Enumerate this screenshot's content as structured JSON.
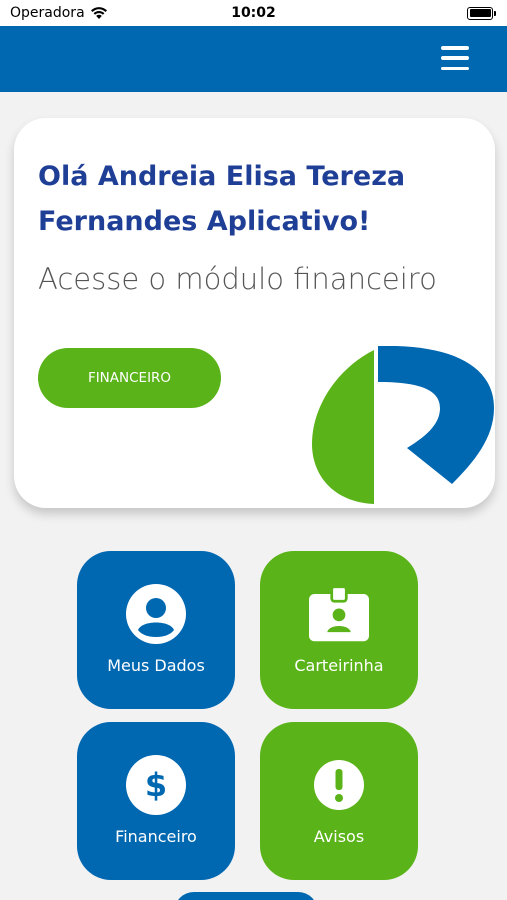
{
  "status_bar": {
    "carrier": "Operadora",
    "time": "10:02"
  },
  "header": {
    "menu_icon": "hamburger-menu-icon",
    "color": "#0067b1"
  },
  "welcome": {
    "greeting": "Olá Andreia Elisa Tereza Fernandes Aplicativo!",
    "subtitle": "Acesse o módulo financeiro",
    "cta_label": "FINANCEIRO",
    "logo_icon": "brand-logo-icon"
  },
  "tiles": [
    {
      "label": "Meus Dados",
      "icon": "user-icon",
      "color": "#0067b1"
    },
    {
      "label": "Carteirinha",
      "icon": "id-badge-icon",
      "color": "#5ab318"
    },
    {
      "label": "Financeiro",
      "icon": "dollar-icon",
      "color": "#0067b1"
    },
    {
      "label": "Avisos",
      "icon": "exclamation-icon",
      "color": "#5ab318"
    }
  ],
  "colors": {
    "primary": "#0067b1",
    "accent": "#5ab318",
    "title": "#1f3f97"
  }
}
